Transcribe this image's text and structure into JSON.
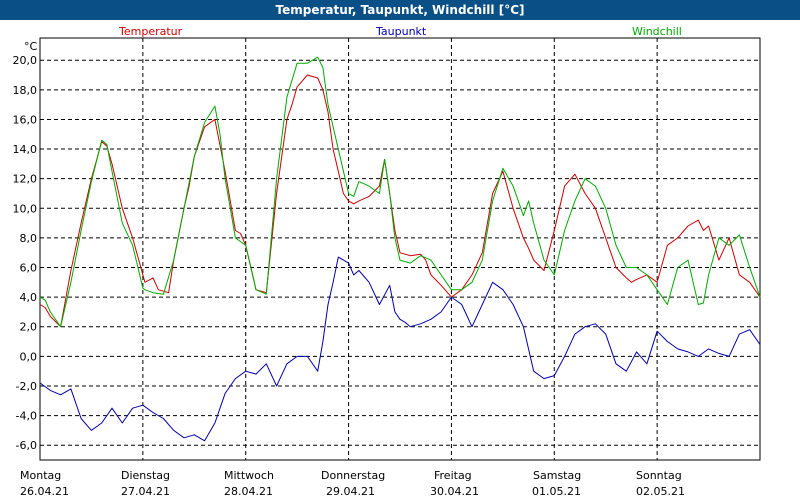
{
  "title": "Temperatur, Taupunkt, Windchill [°C]",
  "colors": {
    "title_bg": "#0b4f87",
    "temperatur": "#cc0000",
    "taupunkt": "#0000aa",
    "windchill": "#00aa00"
  },
  "chart_data": {
    "type": "line",
    "title": "Temperatur, Taupunkt, Windchill [°C]",
    "ylabel": "°C",
    "ylim": [
      -7,
      21.5
    ],
    "yticks": [
      "20,0",
      "18,0",
      "16,0",
      "14,0",
      "12,0",
      "10,0",
      "8,0",
      "6,0",
      "4,0",
      "2,0",
      "0,0",
      "-2,0",
      "-4,0",
      "-6,0"
    ],
    "ytick_values": [
      20,
      18,
      16,
      14,
      12,
      10,
      8,
      6,
      4,
      2,
      0,
      -2,
      -4,
      -6
    ],
    "xlim": [
      0,
      7
    ],
    "day_labels": [
      {
        "day": "Montag",
        "date": "26.04.21"
      },
      {
        "day": "Dienstag",
        "date": "27.04.21"
      },
      {
        "day": "Mittwoch",
        "date": "28.04.21"
      },
      {
        "day": "Donnerstag",
        "date": "29.04.21"
      },
      {
        "day": "Freitag",
        "date": "30.04.21"
      },
      {
        "day": "Samstag",
        "date": "01.05.21"
      },
      {
        "day": "Sonntag",
        "date": "02.05.21"
      }
    ],
    "grid": true,
    "legend": "top",
    "series": [
      {
        "name": "Temperatur",
        "color": "#cc0000",
        "x": [
          0,
          0.05,
          0.1,
          0.2,
          0.3,
          0.4,
          0.5,
          0.6,
          0.65,
          0.7,
          0.8,
          0.9,
          1.0,
          1.02,
          1.1,
          1.15,
          1.25,
          1.3,
          1.4,
          1.45,
          1.5,
          1.6,
          1.7,
          1.8,
          1.9,
          1.95,
          2.0,
          2.1,
          2.2,
          2.3,
          2.4,
          2.45,
          2.5,
          2.6,
          2.7,
          2.75,
          2.8,
          2.85,
          2.9,
          2.95,
          3.0,
          3.05,
          3.1,
          3.2,
          3.3,
          3.35,
          3.4,
          3.45,
          3.5,
          3.6,
          3.7,
          3.75,
          3.8,
          3.9,
          4.0,
          4.1,
          4.2,
          4.3,
          4.4,
          4.5,
          4.6,
          4.7,
          4.75,
          4.8,
          4.9,
          5.0,
          5.1,
          5.2,
          5.3,
          5.4,
          5.5,
          5.6,
          5.7,
          5.75,
          5.8,
          5.9,
          6.0,
          6.1,
          6.2,
          6.3,
          6.4,
          6.45,
          6.5,
          6.6,
          6.7,
          6.8,
          6.9,
          7.0
        ],
        "y": [
          3.5,
          3.3,
          2.7,
          2.0,
          5.8,
          9.0,
          12.0,
          14.5,
          14.2,
          13.0,
          10.0,
          8.0,
          5.5,
          5.0,
          5.3,
          4.5,
          4.3,
          6.5,
          10.0,
          11.5,
          13.5,
          15.5,
          16.0,
          12.5,
          8.5,
          8.3,
          7.5,
          4.5,
          4.3,
          11.0,
          16.0,
          17.0,
          18.2,
          19.0,
          18.8,
          18.0,
          16.5,
          14.0,
          12.5,
          11.0,
          10.5,
          10.3,
          10.5,
          10.8,
          11.5,
          13.3,
          11.0,
          8.5,
          7.0,
          6.8,
          6.9,
          6.5,
          5.5,
          4.8,
          4.0,
          4.5,
          5.5,
          7.0,
          11.0,
          12.5,
          10.0,
          8.0,
          7.3,
          6.5,
          5.8,
          8.5,
          11.5,
          12.3,
          11.0,
          10.0,
          8.0,
          6.0,
          5.3,
          5.0,
          5.2,
          5.5,
          5.0,
          7.5,
          8.0,
          8.8,
          9.2,
          8.5,
          8.8,
          6.5,
          8.0,
          5.5,
          5.0,
          4.0
        ]
      },
      {
        "name": "Taupunkt",
        "color": "#0000aa",
        "x": [
          0,
          0.1,
          0.2,
          0.3,
          0.4,
          0.5,
          0.6,
          0.7,
          0.8,
          0.9,
          1.0,
          1.1,
          1.2,
          1.3,
          1.4,
          1.5,
          1.6,
          1.7,
          1.8,
          1.85,
          1.9,
          2.0,
          2.1,
          2.2,
          2.3,
          2.4,
          2.5,
          2.6,
          2.7,
          2.75,
          2.8,
          2.85,
          2.9,
          3.0,
          3.05,
          3.1,
          3.2,
          3.3,
          3.4,
          3.45,
          3.5,
          3.55,
          3.6,
          3.7,
          3.8,
          3.9,
          4.0,
          4.1,
          4.2,
          4.3,
          4.4,
          4.5,
          4.6,
          4.7,
          4.8,
          4.9,
          5.0,
          5.1,
          5.2,
          5.3,
          5.4,
          5.5,
          5.6,
          5.7,
          5.8,
          5.9,
          6.0,
          6.1,
          6.2,
          6.3,
          6.4,
          6.5,
          6.6,
          6.7,
          6.8,
          6.9,
          7.0
        ],
        "y": [
          -1.8,
          -2.3,
          -2.6,
          -2.2,
          -4.2,
          -5.0,
          -4.5,
          -3.5,
          -4.5,
          -3.5,
          -3.3,
          -3.8,
          -4.2,
          -5.0,
          -5.5,
          -5.3,
          -5.7,
          -4.5,
          -2.5,
          -2.0,
          -1.5,
          -1.0,
          -1.2,
          -0.5,
          -2.0,
          -0.5,
          0.0,
          0.0,
          -1.0,
          1.0,
          3.5,
          5.0,
          6.7,
          6.3,
          5.5,
          5.8,
          5.0,
          3.5,
          4.8,
          3.0,
          2.5,
          2.3,
          2.0,
          2.2,
          2.5,
          3.0,
          4.0,
          3.5,
          2.0,
          3.5,
          5.0,
          4.5,
          3.5,
          2.0,
          -1.0,
          -1.5,
          -1.3,
          0.0,
          1.5,
          2.0,
          2.2,
          1.5,
          -0.5,
          -1.0,
          0.3,
          -0.5,
          1.7,
          1.0,
          0.5,
          0.3,
          0.0,
          0.5,
          0.2,
          0.0,
          1.5,
          1.8,
          0.8
        ]
      },
      {
        "name": "Windchill",
        "color": "#00aa00",
        "x": [
          0,
          0.05,
          0.1,
          0.2,
          0.3,
          0.4,
          0.5,
          0.6,
          0.65,
          0.7,
          0.8,
          0.9,
          1.0,
          1.02,
          1.1,
          1.2,
          1.3,
          1.4,
          1.5,
          1.6,
          1.7,
          1.75,
          1.8,
          1.9,
          2.0,
          2.1,
          2.2,
          2.3,
          2.4,
          2.5,
          2.6,
          2.7,
          2.75,
          2.8,
          2.9,
          3.0,
          3.05,
          3.1,
          3.2,
          3.3,
          3.35,
          3.4,
          3.45,
          3.5,
          3.6,
          3.7,
          3.8,
          3.9,
          4.0,
          4.1,
          4.2,
          4.3,
          4.4,
          4.5,
          4.6,
          4.7,
          4.75,
          4.8,
          4.9,
          5.0,
          5.1,
          5.2,
          5.3,
          5.4,
          5.5,
          5.6,
          5.7,
          5.8,
          5.9,
          6.0,
          6.1,
          6.2,
          6.3,
          6.4,
          6.45,
          6.5,
          6.6,
          6.7,
          6.8,
          6.9,
          7.0
        ],
        "y": [
          4.0,
          3.8,
          3.0,
          2.0,
          5.0,
          8.5,
          11.8,
          14.6,
          14.3,
          12.5,
          9.0,
          7.5,
          4.6,
          4.5,
          4.3,
          4.2,
          6.5,
          10.0,
          13.5,
          15.8,
          16.9,
          15.0,
          12.0,
          8.0,
          7.5,
          4.5,
          4.2,
          12.0,
          17.5,
          19.8,
          19.8,
          20.2,
          19.5,
          17.0,
          14.0,
          11.0,
          10.8,
          11.8,
          11.5,
          11.0,
          13.3,
          11.0,
          8.0,
          6.5,
          6.3,
          6.8,
          6.5,
          5.5,
          4.5,
          4.5,
          5.0,
          6.5,
          10.5,
          12.7,
          11.5,
          9.5,
          10.5,
          9.0,
          6.5,
          5.5,
          8.5,
          10.5,
          12.0,
          11.5,
          10.0,
          7.5,
          6.0,
          6.0,
          5.5,
          4.5,
          3.5,
          6.0,
          6.5,
          3.5,
          3.6,
          5.5,
          8.0,
          7.5,
          8.2,
          6.0,
          4.0
        ]
      }
    ]
  }
}
